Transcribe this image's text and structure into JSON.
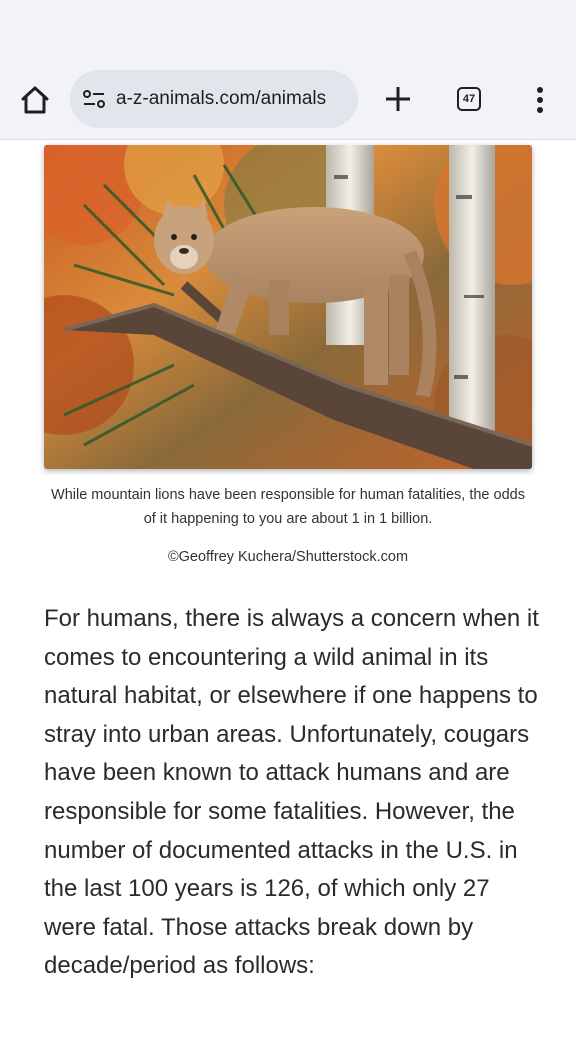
{
  "browser": {
    "url": "a-z-animals.com/animals",
    "tab_count": "47",
    "icons": {
      "home": "home-icon",
      "site_settings": "tune-icon",
      "new_tab": "plus-icon",
      "tabs": "tab-switcher-icon",
      "menu": "more-vert-icon"
    }
  },
  "article": {
    "image_alt": "mountain-lion-on-fallen-tree",
    "caption": "While mountain lions have been responsible for human fatalities, the odds of it happening to you are about 1 in 1 billion.",
    "credit": "©Geoffrey Kuchera/Shutterstock.com",
    "paragraph": "For humans, there is always a concern when it comes to encountering a wild animal in its natural habitat, or elsewhere if one happens to stray into urban areas. Unfortunately, cougars have been known to attack humans and are responsible for some fatalities. However, the number of documented attacks in the U.S. in the last 100 years is 126, of which only 27 were fatal. Those attacks break down by decade/period as follows:"
  }
}
